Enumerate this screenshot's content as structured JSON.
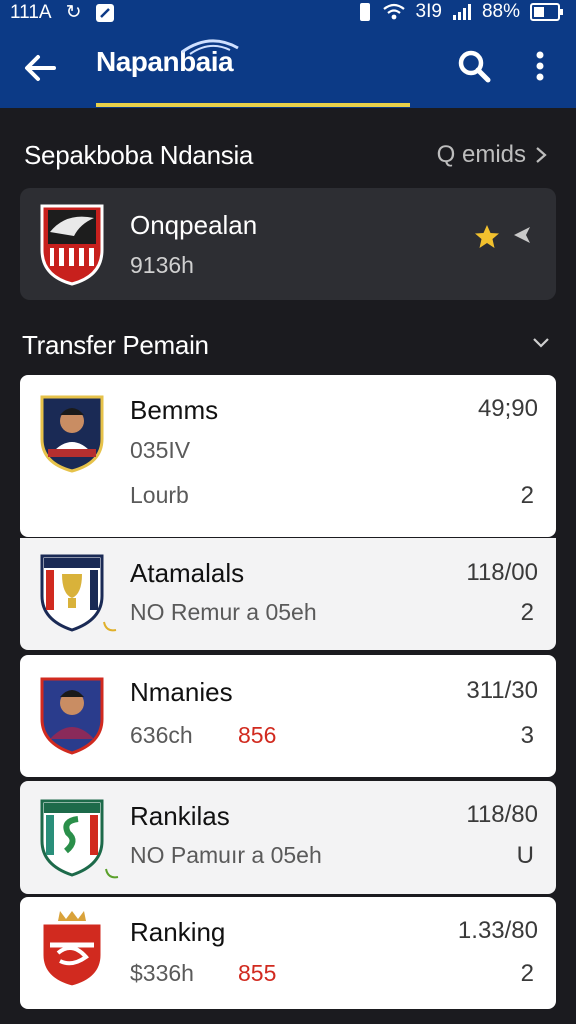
{
  "status": {
    "time": "111A",
    "signal": "3I9",
    "battery": "88%"
  },
  "app": {
    "title": "Napanbaia"
  },
  "section1": {
    "title": "Sepakboba Ndansia",
    "more": "Q emids"
  },
  "match": {
    "name": "Onqpealan",
    "time": "9136h"
  },
  "section2": {
    "title": "Transfer Pemain"
  },
  "rows": [
    {
      "name": "Bemms",
      "sub": "035IV",
      "sub2": "Lourb",
      "score": "49;90",
      "count": "2"
    },
    {
      "name": "Atamalals",
      "sub": "NO Remur a 05eh",
      "score": "118/00",
      "count": "2"
    },
    {
      "name": "Nmanies",
      "sub": "636ch",
      "extra": "856",
      "score": "311/30",
      "count": "3"
    },
    {
      "name": "Rankilas",
      "sub": "NO Pamuır a 05eh",
      "score": "118/80",
      "count": "U"
    },
    {
      "name": "Ranking",
      "sub": "$336h",
      "extra": "855",
      "score": "1.33/80",
      "count": "2"
    }
  ],
  "colors": {
    "appbar": "#0c3a86",
    "accent": "#e8d04a",
    "highlight": "#d12a1f"
  }
}
